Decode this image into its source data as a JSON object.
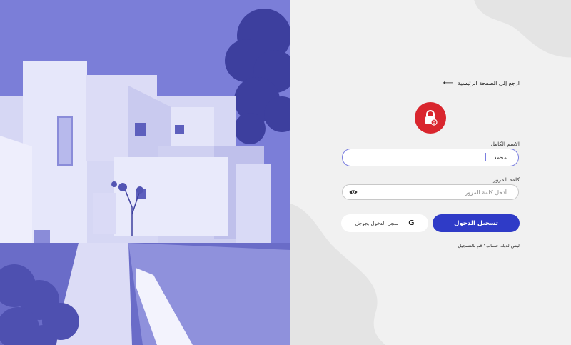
{
  "back_link": {
    "label": "ارجع إلى الصفحة الرئيسية",
    "icon": "arrow-left-icon"
  },
  "lock": {
    "icon": "lock-icon",
    "color": "#d9262e"
  },
  "name_field": {
    "label": "الاسم الكامل",
    "value": "محمد"
  },
  "password_field": {
    "label": "كلمة المرور",
    "placeholder": "أدخل كلمة المرور",
    "icon": "eye-icon"
  },
  "buttons": {
    "login": "تسجيل الدخول",
    "google": "سجل الدخول بجوجل",
    "google_icon": "google-icon"
  },
  "register_text": "ليس لديك حساب؟ قم بالتسجيل",
  "colors": {
    "accent": "#2f3bc7",
    "hero_tint": "#7d7fd9",
    "lock": "#d9262e"
  }
}
